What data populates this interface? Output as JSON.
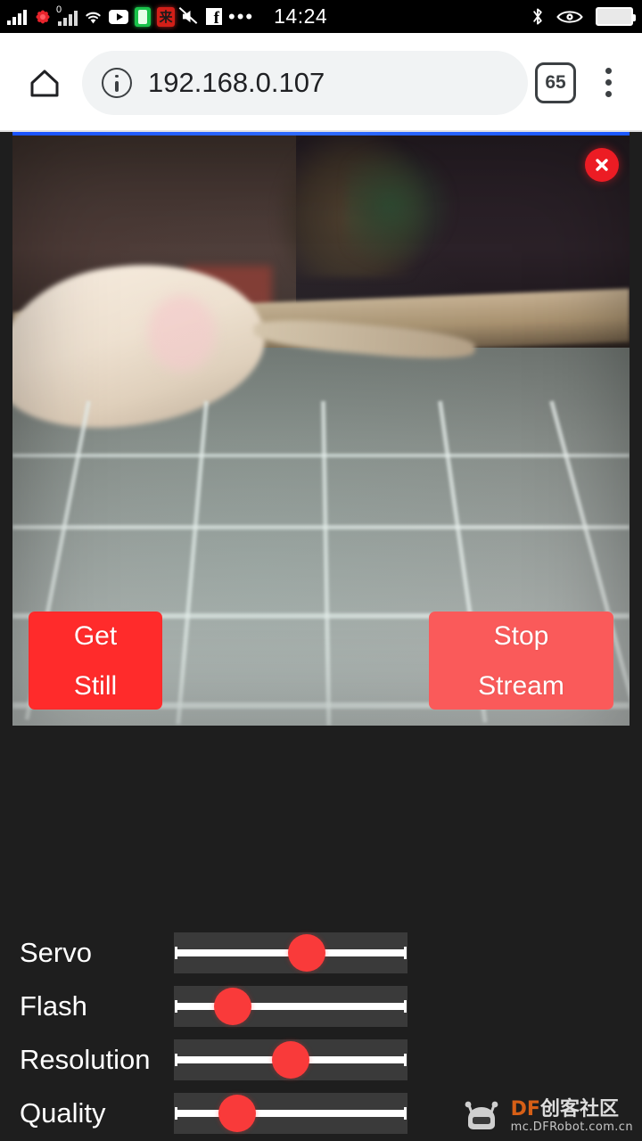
{
  "statusbar": {
    "clock": "14:24",
    "left_icons": [
      {
        "name": "cellular-signal-icon",
        "glyph": "signal"
      },
      {
        "name": "flower-app-icon",
        "glyph": "flower"
      },
      {
        "name": "cellular-signal-2-icon",
        "glyph": "signal-0"
      },
      {
        "name": "wifi-icon",
        "glyph": "wifi"
      },
      {
        "name": "youtube-icon",
        "glyph": "youtube"
      },
      {
        "name": "green-app-icon",
        "glyph": "green-app"
      },
      {
        "name": "red-app-icon",
        "glyph": "red-app",
        "label": "来"
      },
      {
        "name": "mute-icon",
        "glyph": "mute"
      },
      {
        "name": "facebook-icon",
        "glyph": "facebook"
      },
      {
        "name": "more-icons-icon",
        "glyph": "dots"
      }
    ],
    "right_icons": [
      {
        "name": "bluetooth-icon",
        "glyph": "bluetooth"
      },
      {
        "name": "eye-care-icon",
        "glyph": "eye"
      },
      {
        "name": "battery-icon",
        "glyph": "battery"
      }
    ]
  },
  "browser": {
    "home_label": "Home",
    "url": "192.168.0.107",
    "tab_count": "65",
    "menu_label": "More options"
  },
  "stream": {
    "close_label": "×",
    "alt": "Live camera stream showing a blurry cream cylindrical object on a tiled floor"
  },
  "buttons": {
    "get_still": {
      "line1": "Get",
      "line2": "Still",
      "color": "#ff2b2b"
    },
    "stop_stream": {
      "line1": "Stop",
      "line2": "Stream",
      "color": "#fa5a5a"
    }
  },
  "controls": {
    "accent_color": "#f93a3a",
    "sliders": [
      {
        "label": "Servo",
        "percent": 57
      },
      {
        "label": "Flash",
        "percent": 25
      },
      {
        "label": "Resolution",
        "percent": 50
      },
      {
        "label": "Quality",
        "percent": 27
      }
    ]
  },
  "watermark": {
    "brand_prefix": "DF",
    "brand_suffix": "创客社区",
    "url": "mc.DFRobot.com.cn"
  }
}
